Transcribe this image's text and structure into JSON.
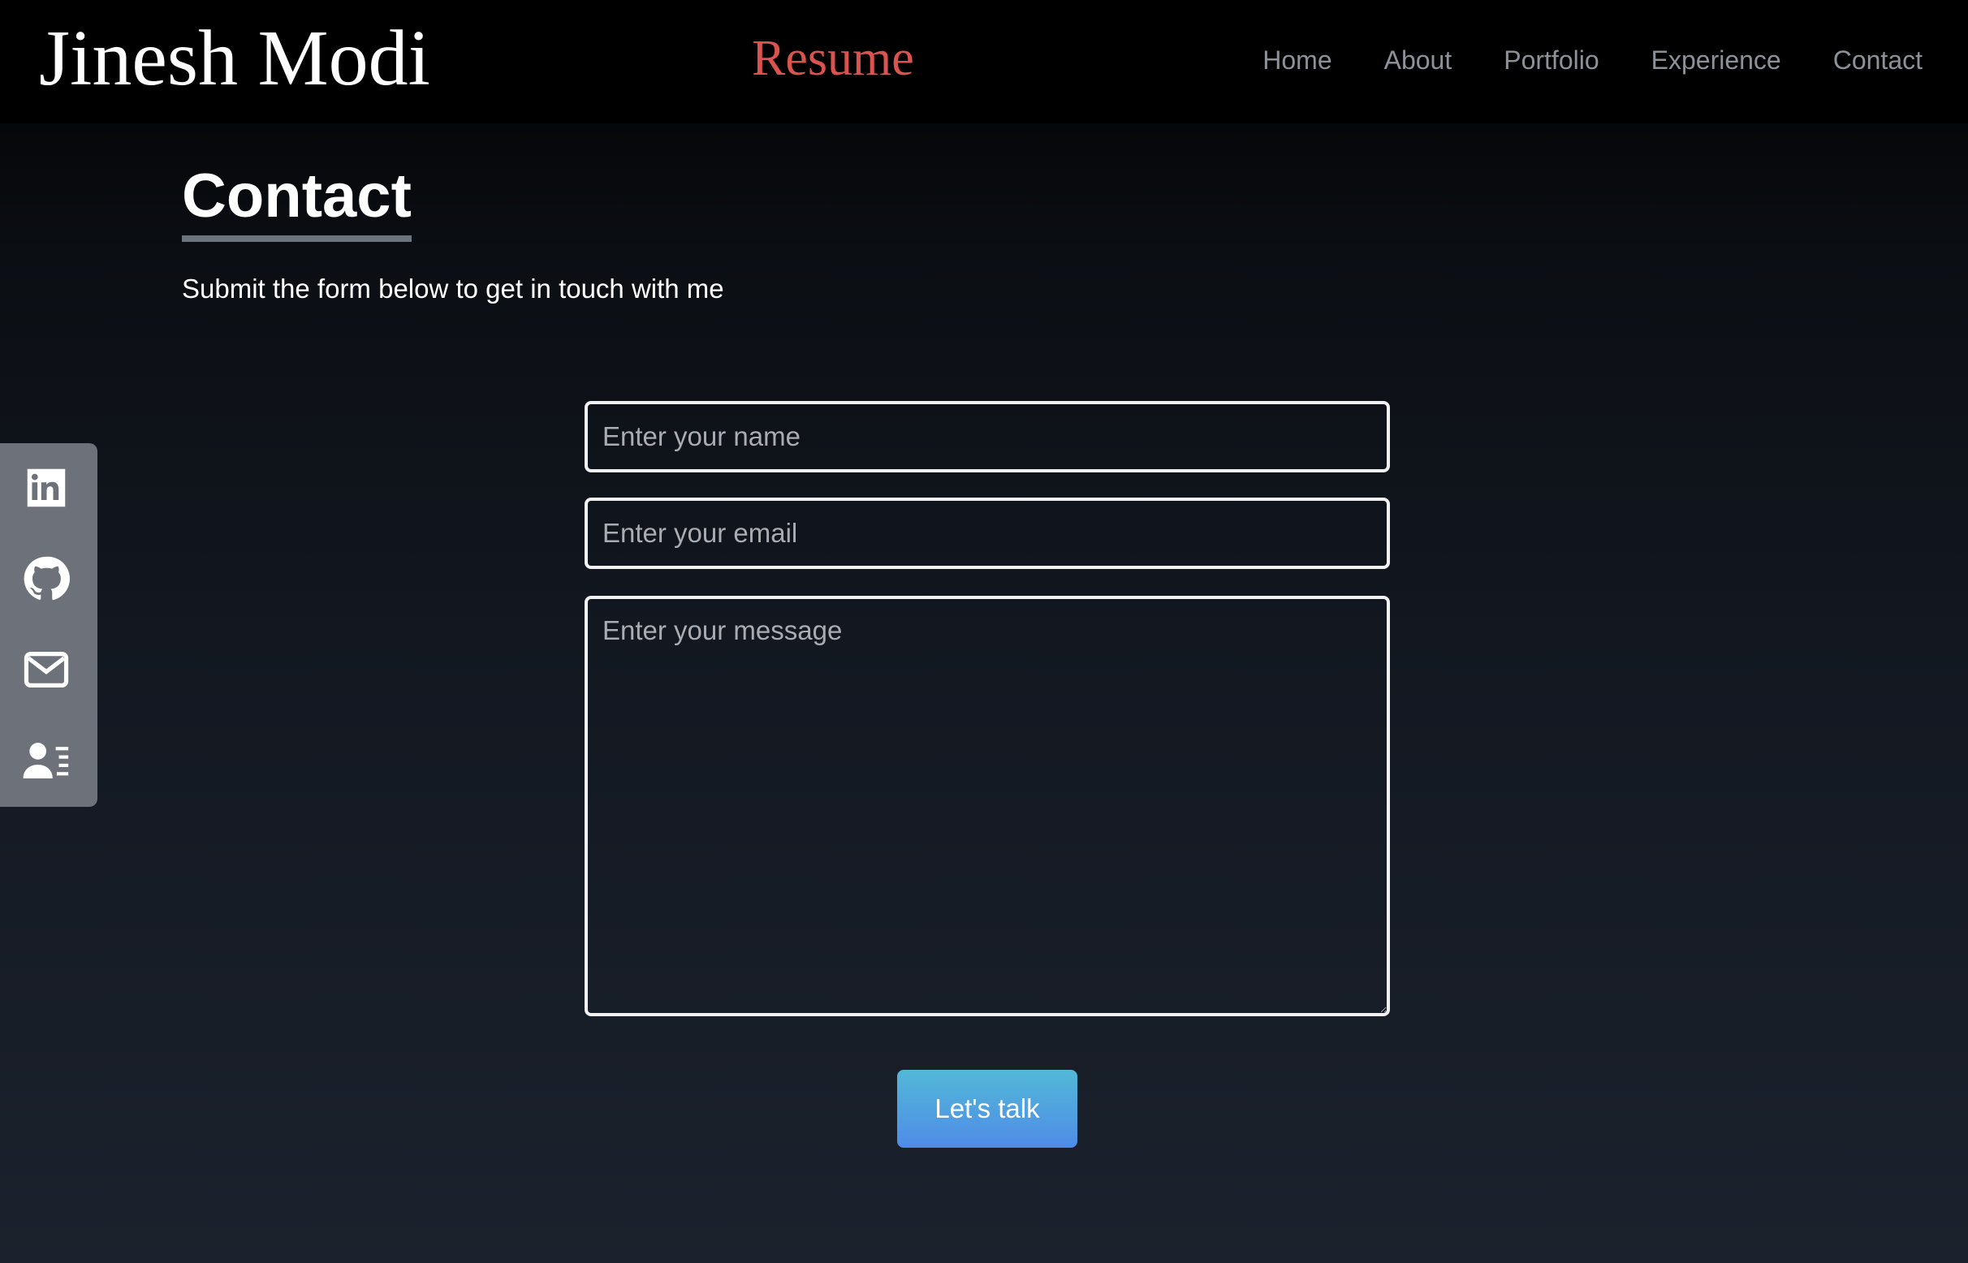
{
  "header": {
    "brand": "Jinesh Modi",
    "resume_label": "Resume",
    "nav": [
      "Home",
      "About",
      "Portfolio",
      "Experience",
      "Contact"
    ]
  },
  "contact": {
    "title": "Contact",
    "subtitle": "Submit the form below to get in touch with me",
    "name_placeholder": "Enter your name",
    "email_placeholder": "Enter your email",
    "message_placeholder": "Enter your message",
    "submit_label": "Let's talk"
  },
  "social": {
    "icons": [
      "linkedin-icon",
      "github-icon",
      "mail-icon",
      "contact-card-icon"
    ]
  },
  "colors": {
    "resume": "#d9534f",
    "nav": "#8d929a",
    "sidebar": "#6d7179",
    "button_top": "#52b8d6",
    "button_bottom": "#4f8ce8"
  }
}
